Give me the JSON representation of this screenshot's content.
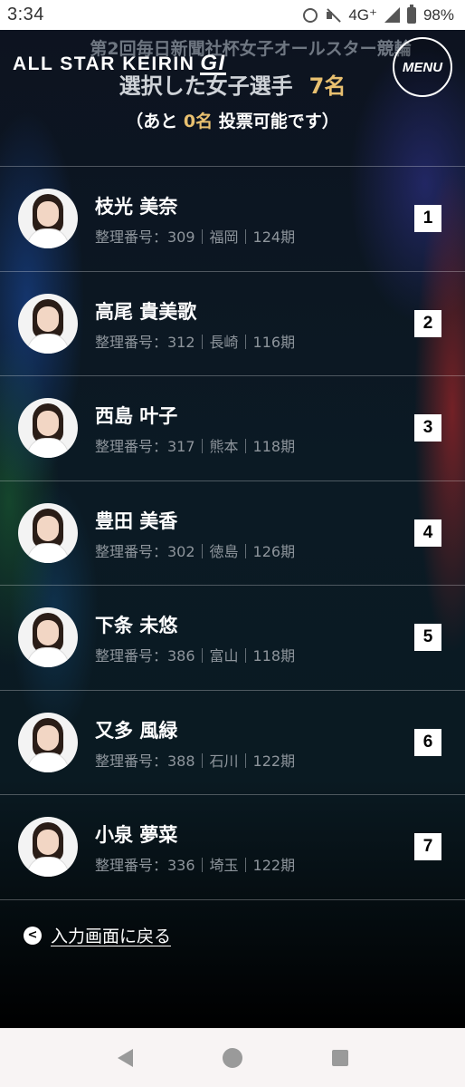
{
  "status_bar": {
    "time": "3:34",
    "network": "4G⁺",
    "battery": "98%"
  },
  "header": {
    "subtitle": "第2回毎日新聞社杯女子オールスター競輪",
    "logo_text": "ALL STAR KEIRIN",
    "logo_grade": "GI",
    "menu_label": "MENU",
    "title": "選択した女子選手",
    "selected_count": "7名",
    "remain_prefix": "（あと",
    "remain_count": "0名",
    "remain_suffix": "投票可能です）"
  },
  "riders": [
    {
      "name": "枝光 美奈",
      "info": "整理番号：309｜福岡｜124期",
      "rank": "1"
    },
    {
      "name": "高尾 貴美歌",
      "info": "整理番号：312｜長崎｜116期",
      "rank": "2"
    },
    {
      "name": "西島 叶子",
      "info": "整理番号：317｜熊本｜118期",
      "rank": "3"
    },
    {
      "name": "豊田 美香",
      "info": "整理番号：302｜徳島｜126期",
      "rank": "4"
    },
    {
      "name": "下条 未悠",
      "info": "整理番号：386｜富山｜118期",
      "rank": "5"
    },
    {
      "name": "又多 風緑",
      "info": "整理番号：388｜石川｜122期",
      "rank": "6"
    },
    {
      "name": "小泉 夢菜",
      "info": "整理番号：336｜埼玉｜122期",
      "rank": "7"
    }
  ],
  "back_link": {
    "label": "入力画面に戻る"
  },
  "icons": {
    "alarm": "alarm-icon",
    "mute": "vibrate-off-icon",
    "signal": "signal-icon",
    "battery": "battery-icon",
    "back_chevron": "chevron-left-icon",
    "nav_back": "nav-back-icon",
    "nav_home": "nav-home-icon",
    "nav_recent": "nav-recents-icon"
  },
  "colors": {
    "accent": "#e8c070",
    "rank_bg": "#ffffff"
  }
}
